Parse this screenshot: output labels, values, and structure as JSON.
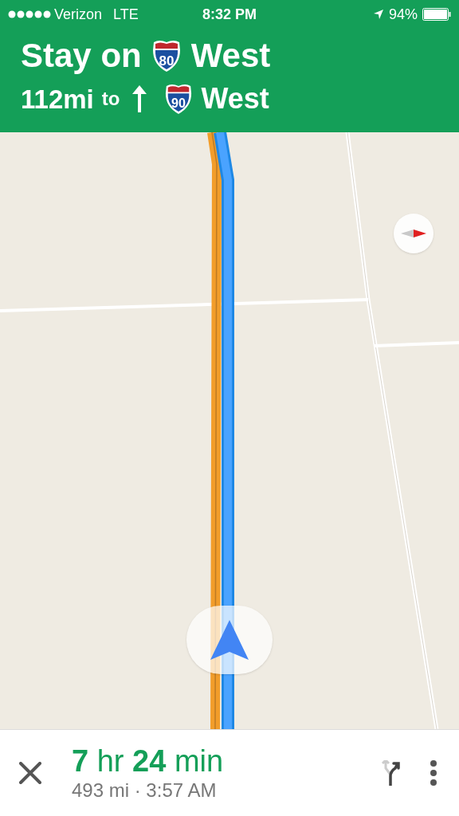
{
  "status_bar": {
    "carrier": "Verizon",
    "network": "LTE",
    "time": "8:32 PM",
    "battery": "94%"
  },
  "banner": {
    "primary": {
      "before": "Stay on",
      "shield": "80",
      "after": "West"
    },
    "secondary": {
      "distance": "112mi",
      "connector": "to",
      "shield": "90",
      "after": "West"
    }
  },
  "trip": {
    "duration": "**7** hr **24** min",
    "details": "493 mi · 3:57 AM"
  }
}
